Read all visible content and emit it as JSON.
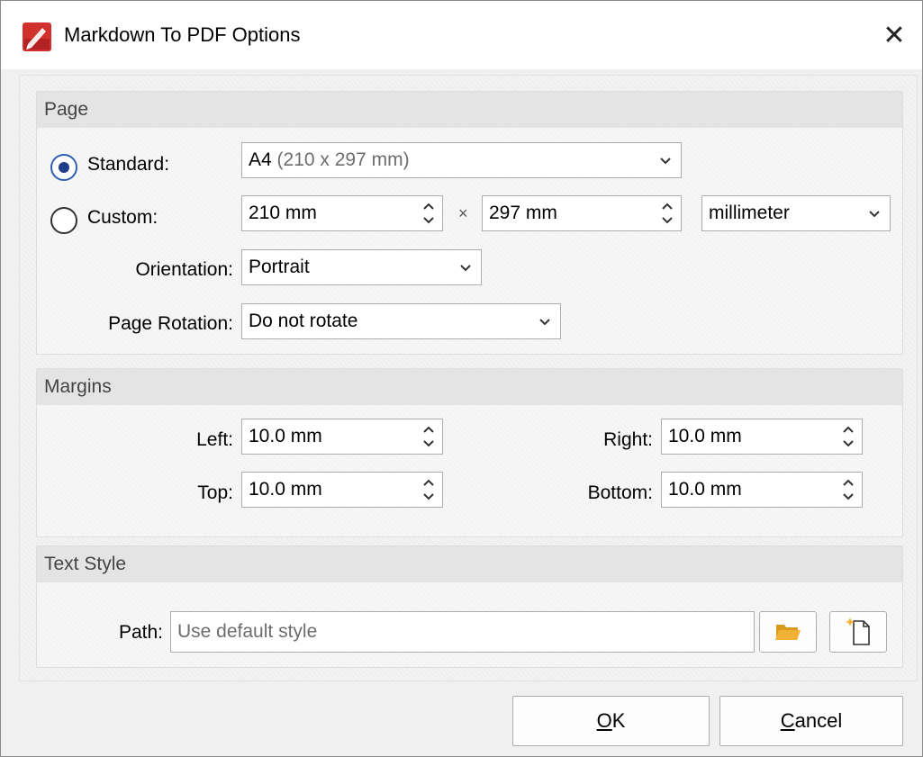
{
  "window": {
    "title": "Markdown To PDF Options",
    "close_glyph": "✕"
  },
  "page": {
    "header": "Page",
    "standard_label": "Standard:",
    "standard_value_bold": "A4",
    "standard_value_extra": " (210 x 297 mm)",
    "standard_selected": true,
    "custom_label": "Custom:",
    "custom_width": "210 mm",
    "times_glyph": "×",
    "custom_height": "297 mm",
    "unit": "millimeter",
    "orientation_label": "Orientation:",
    "orientation_value": "Portrait",
    "rotation_label": "Page Rotation:",
    "rotation_value": "Do not rotate"
  },
  "margins": {
    "header": "Margins",
    "left_label": "Left:",
    "left_value": "10.0 mm",
    "right_label": "Right:",
    "right_value": "10.0 mm",
    "top_label": "Top:",
    "top_value": "10.0 mm",
    "bottom_label": "Bottom:",
    "bottom_value": "10.0 mm"
  },
  "text_style": {
    "header": "Text Style",
    "path_label": "Path:",
    "path_placeholder": "Use default style",
    "browse_icon": "folder-icon",
    "new_icon": "new-file-icon"
  },
  "buttons": {
    "ok_mnemonic": "O",
    "ok_rest": "K",
    "cancel_mnemonic": "C",
    "cancel_rest": "ancel"
  },
  "colors": {
    "accent": "#3060b6",
    "app_icon": "#d0312d",
    "folder": "#f2b134"
  }
}
